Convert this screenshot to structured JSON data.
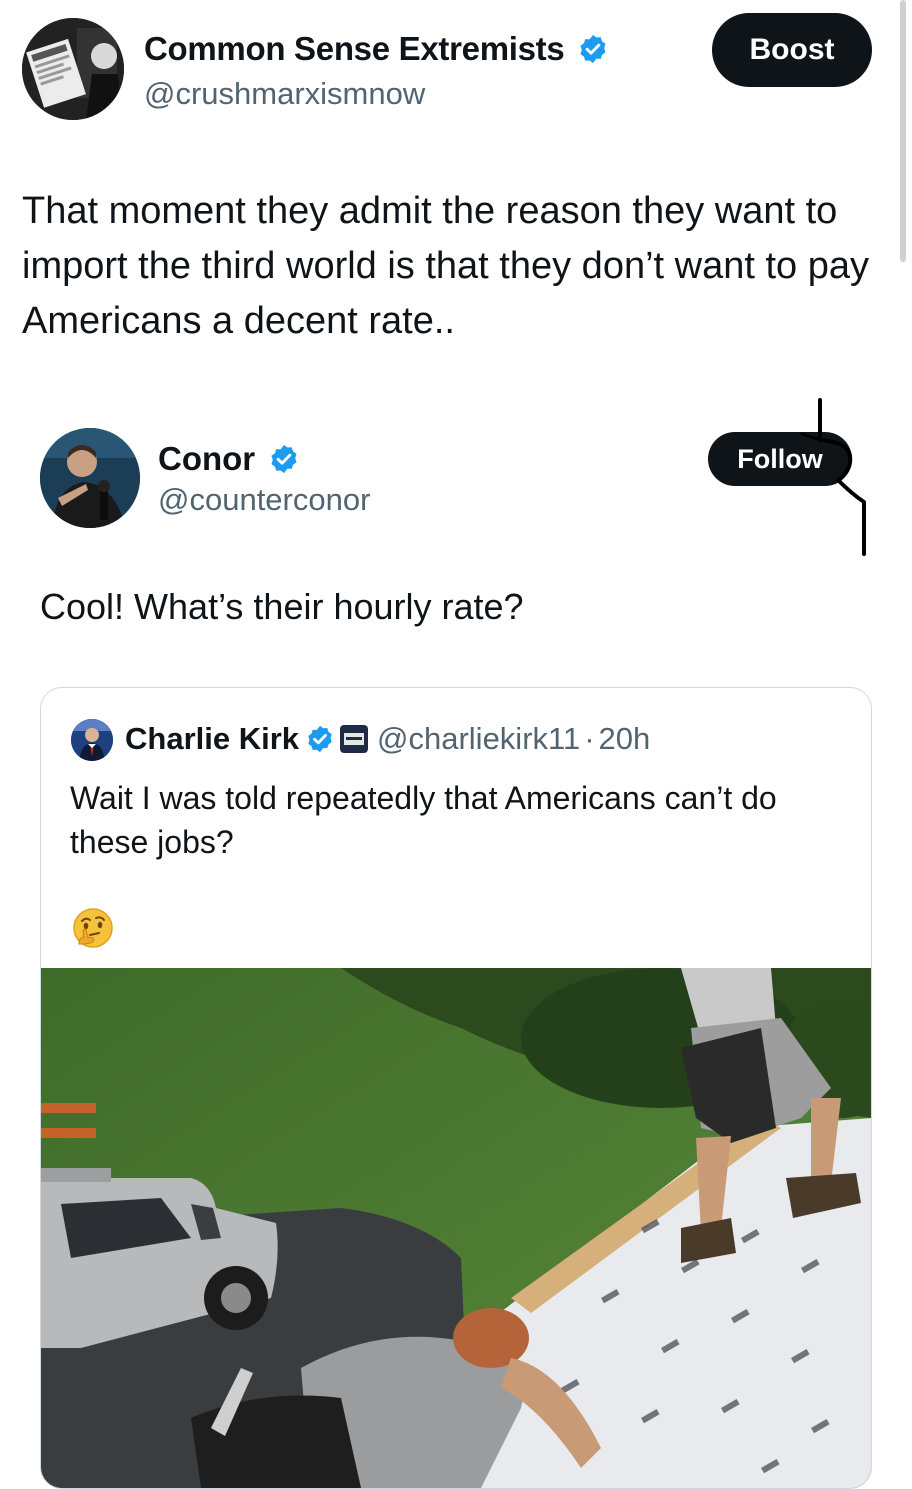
{
  "tweet": {
    "author_name": "Common Sense Extremists",
    "author_handle": "@crushmarxismnow",
    "boost_label": "Boost",
    "text": "That moment they admit the reason they want to import the third world is that they don’t want to pay Americans a decent rate..",
    "verified_icon": "verified-badge-icon"
  },
  "reply": {
    "author_name": "Conor",
    "author_handle": "@counterconor",
    "follow_label": "Follow",
    "text": "Cool!  What’s their hourly rate?"
  },
  "quote": {
    "author_name": "Charlie Kirk",
    "author_handle": "@charliekirk11",
    "separator": "·",
    "time": "20h",
    "text": "Wait I was told repeatedly that Americans can’t do these jobs?",
    "emoji_icon": "thinking-face-icon"
  },
  "colors": {
    "text": "#0f1419",
    "secondary": "#536471",
    "verified": "#1d9bf0",
    "button": "#0f1419",
    "border": "#cfd9de"
  }
}
